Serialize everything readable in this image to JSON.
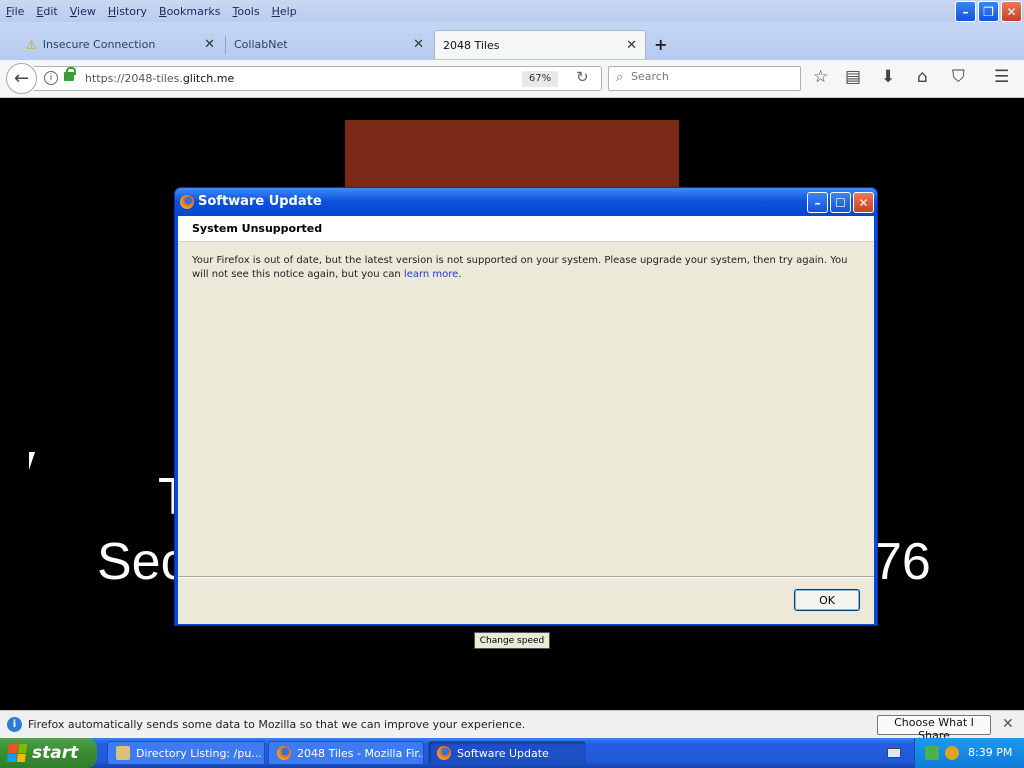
{
  "menubar": {
    "items": [
      "File",
      "Edit",
      "View",
      "History",
      "Bookmarks",
      "Tools",
      "Help"
    ]
  },
  "tabs": [
    {
      "label": "Insecure Connection",
      "warning": true,
      "selected": false
    },
    {
      "label": "CollabNet",
      "warning": false,
      "selected": false
    },
    {
      "label": "2048 Tiles",
      "warning": false,
      "selected": true
    }
  ],
  "navbar": {
    "url_prefix": "https://2048-tiles.",
    "url_domain": "glitch.me",
    "zoom": "67%",
    "search_placeholder": "Search"
  },
  "page": {
    "partial_line1": "T",
    "partial_line2_left": "Sec",
    "partial_line2_right": "76",
    "change_speed_label": "Change speed",
    "tile_color": "#7a2916"
  },
  "dialog": {
    "title": "Software Update",
    "heading": "System Unsupported",
    "message": "Your Firefox is out of date, but the latest version is not supported on your system. Please upgrade your system, then try again. You will not see this notice again, but you can ",
    "link_text": "learn more",
    "message_end": ".",
    "ok_label": "OK"
  },
  "notification": {
    "text": "Firefox automatically sends some data to Mozilla so that we can improve your experience.",
    "button_label": "Choose What I Share"
  },
  "taskbar": {
    "start_label": "start",
    "tasks": [
      {
        "label": "Directory Listing: /pu...",
        "icon": "folder-icon"
      },
      {
        "label": "2048 Tiles - Mozilla Fir...",
        "icon": "firefox-icon"
      },
      {
        "label": "Software Update",
        "icon": "firefox-icon",
        "active": true
      }
    ],
    "clock": "8:39 PM"
  }
}
